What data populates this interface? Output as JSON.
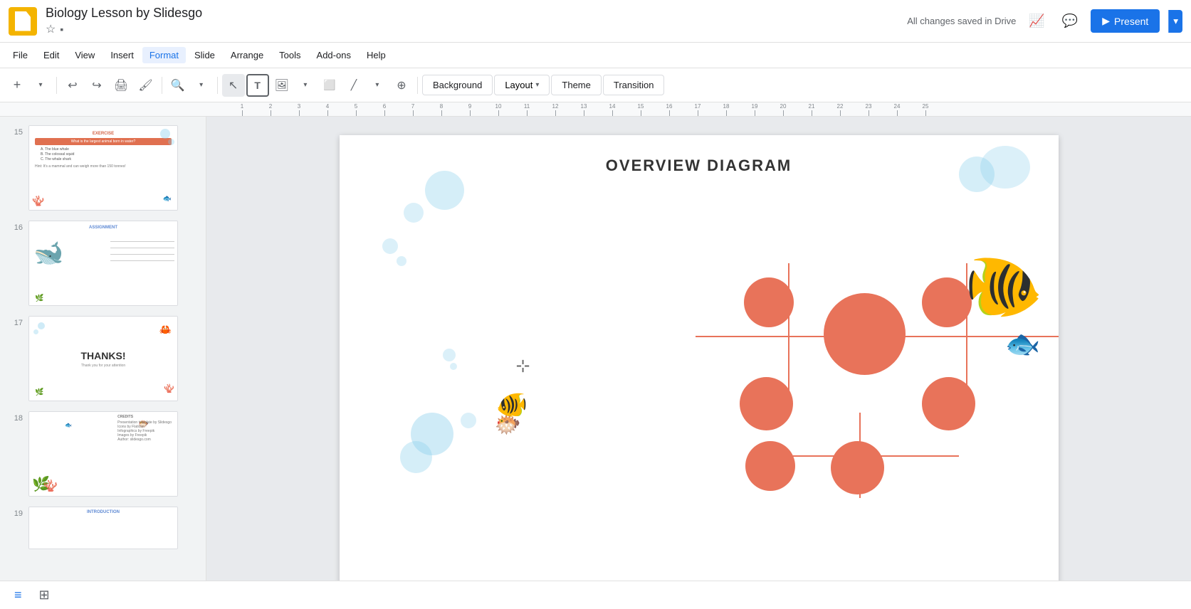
{
  "app": {
    "name": "Google Slides",
    "icon_color": "#f4b400"
  },
  "document": {
    "title": "Biology Lesson by Slidesgo",
    "save_status": "All changes saved in Drive"
  },
  "menu": {
    "items": [
      "File",
      "Edit",
      "View",
      "Insert",
      "Format",
      "Slide",
      "Arrange",
      "Tools",
      "Add-ons",
      "Help"
    ]
  },
  "toolbar": {
    "zoom_level": "Zoom",
    "bg_btn": "Background",
    "layout_btn": "Layout",
    "theme_btn": "Theme",
    "transition_btn": "Transition"
  },
  "header": {
    "present_label": "Present",
    "comments_icon": "💬",
    "activity_icon": "📈"
  },
  "slides": [
    {
      "num": 15,
      "type": "quiz",
      "title": "EXERCISE"
    },
    {
      "num": 16,
      "type": "assignment",
      "title": "ASSIGNMENT"
    },
    {
      "num": 17,
      "type": "thanks",
      "title": "THANKS!"
    },
    {
      "num": 18,
      "type": "credits",
      "title": "CREDITS"
    },
    {
      "num": 19,
      "type": "extra",
      "title": "INTRODUCTION"
    }
  ],
  "current_slide": {
    "title": "OVERVIEW DIAGRAM",
    "type": "overview_diagram"
  },
  "view_buttons": {
    "list_view_label": "≡",
    "grid_view_label": "⊞"
  }
}
